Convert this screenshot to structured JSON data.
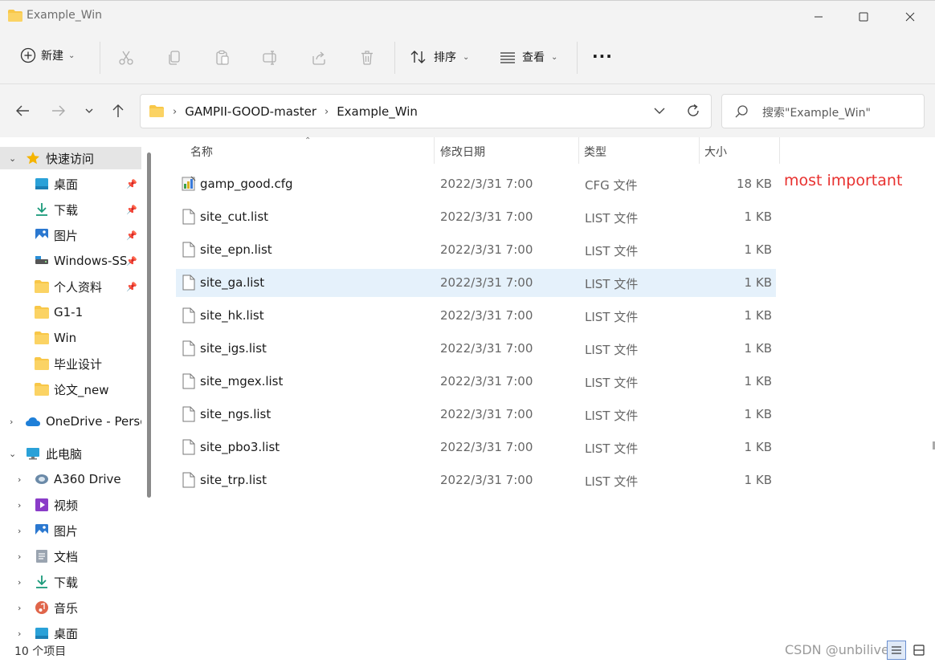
{
  "window": {
    "title": "Example_Win"
  },
  "toolbar": {
    "new_label": "新建",
    "sort_label": "排序",
    "view_label": "查看",
    "more_label": "···"
  },
  "address": {
    "crumbs": [
      "GAMPII-GOOD-master",
      "Example_Win"
    ]
  },
  "search": {
    "placeholder": "搜索\"Example_Win\""
  },
  "sidebar": {
    "quick_access": "快速访问",
    "pinned": [
      "桌面",
      "下载",
      "图片",
      "Windows-SS",
      "个人资料"
    ],
    "folders": [
      "G1-1",
      "Win",
      "毕业设计",
      "论文_new"
    ],
    "onedrive": "OneDrive - Perso",
    "this_pc": "此电脑",
    "pc_items": [
      "A360 Drive",
      "视频",
      "图片",
      "文档",
      "下载",
      "音乐",
      "桌面"
    ]
  },
  "columns": {
    "name": "名称",
    "date": "修改日期",
    "type": "类型",
    "size": "大小"
  },
  "files": [
    {
      "name": "gamp_good.cfg",
      "date": "2022/3/31 7:00",
      "type": "CFG 文件",
      "size": "18 KB"
    },
    {
      "name": "site_cut.list",
      "date": "2022/3/31 7:00",
      "type": "LIST 文件",
      "size": "1 KB"
    },
    {
      "name": "site_epn.list",
      "date": "2022/3/31 7:00",
      "type": "LIST 文件",
      "size": "1 KB"
    },
    {
      "name": "site_ga.list",
      "date": "2022/3/31 7:00",
      "type": "LIST 文件",
      "size": "1 KB"
    },
    {
      "name": "site_hk.list",
      "date": "2022/3/31 7:00",
      "type": "LIST 文件",
      "size": "1 KB"
    },
    {
      "name": "site_igs.list",
      "date": "2022/3/31 7:00",
      "type": "LIST 文件",
      "size": "1 KB"
    },
    {
      "name": "site_mgex.list",
      "date": "2022/3/31 7:00",
      "type": "LIST 文件",
      "size": "1 KB"
    },
    {
      "name": "site_ngs.list",
      "date": "2022/3/31 7:00",
      "type": "LIST 文件",
      "size": "1 KB"
    },
    {
      "name": "site_pbo3.list",
      "date": "2022/3/31 7:00",
      "type": "LIST 文件",
      "size": "1 KB"
    },
    {
      "name": "site_trp.list",
      "date": "2022/3/31 7:00",
      "type": "LIST 文件",
      "size": "1 KB"
    }
  ],
  "annotation": "most important",
  "status": {
    "count": "10 个项目"
  },
  "watermark": "CSDN @unbilivebd",
  "colors": {
    "accent": "#0067c0",
    "folder": "#f8c748",
    "selection": "#e5f1fb",
    "annotation": "#e8312f"
  }
}
